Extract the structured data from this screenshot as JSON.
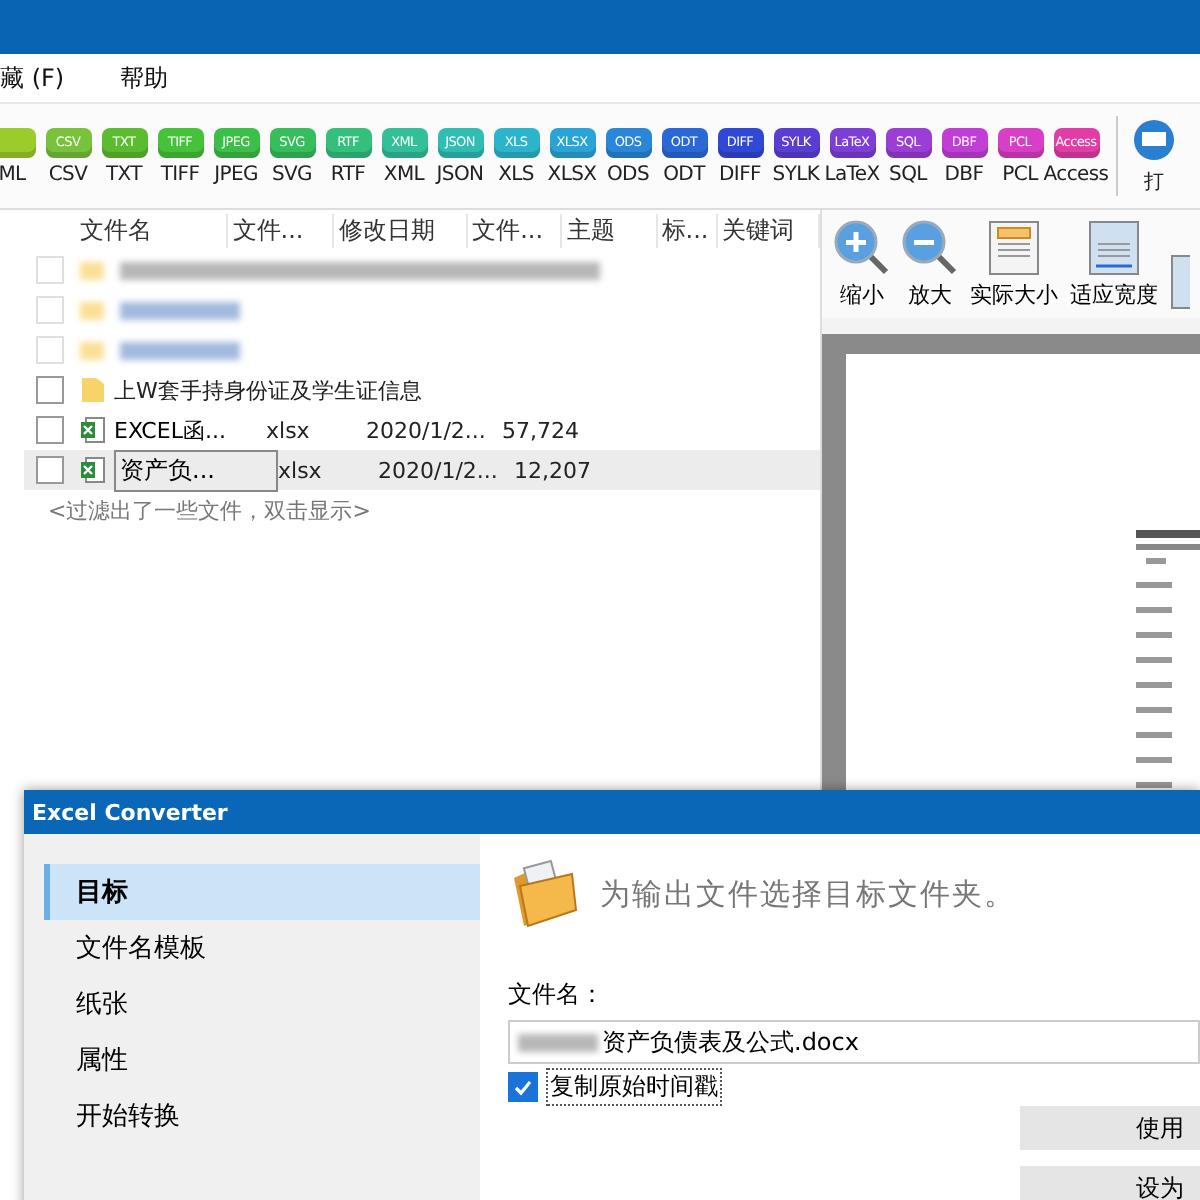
{
  "menu": [
    {
      "label": "藏 (F)"
    },
    {
      "label": "帮助"
    }
  ],
  "formats": [
    {
      "label": "ML",
      "color": "#9ccc2c"
    },
    {
      "badge": "CSV",
      "label": "CSV",
      "color": "#78c23c"
    },
    {
      "badge": "TXT",
      "label": "TXT",
      "color": "#5cbc30"
    },
    {
      "badge": "TIFF",
      "label": "TIFF",
      "color": "#46c23a"
    },
    {
      "badge": "JPEG",
      "label": "JPEG",
      "color": "#3cbf48"
    },
    {
      "badge": "SVG",
      "label": "SVG",
      "color": "#36be5c"
    },
    {
      "badge": "RTF",
      "label": "RTF",
      "color": "#34c07c"
    },
    {
      "badge": "XML",
      "label": "XML",
      "color": "#33bf98"
    },
    {
      "badge": "JSON",
      "label": "JSON",
      "color": "#2fbdb4"
    },
    {
      "badge": "XLS",
      "label": "XLS",
      "color": "#2cb4cc"
    },
    {
      "badge": "XLSX",
      "label": "XLSX",
      "color": "#2aa4d6"
    },
    {
      "badge": "ODS",
      "label": "ODS",
      "color": "#2a86d6"
    },
    {
      "badge": "ODT",
      "label": "ODT",
      "color": "#2a68d6"
    },
    {
      "badge": "DIFF",
      "label": "DIFF",
      "color": "#3048d6"
    },
    {
      "badge": "SYLK",
      "label": "SYLK",
      "color": "#5a3ed4"
    },
    {
      "badge": "LaTeX",
      "label": "LaTeX",
      "color": "#7c3ed6"
    },
    {
      "badge": "SQL",
      "label": "SQL",
      "color": "#9a3ed6"
    },
    {
      "badge": "DBF",
      "label": "DBF",
      "color": "#c03ed6"
    },
    {
      "badge": "PCL",
      "label": "PCL",
      "color": "#d83ec6"
    },
    {
      "badge": "Access",
      "label": "Access",
      "color": "#e03ea6"
    }
  ],
  "print_label": "打",
  "file_list": {
    "columns": [
      "文件名",
      "文件...",
      "修改日期",
      "文件...",
      "主题",
      "标...",
      "关键词"
    ],
    "redacted_rows": [
      {
        "checked": false
      },
      {
        "checked": false
      },
      {
        "checked": false
      }
    ],
    "rows": [
      {
        "kind": "folder",
        "name": "上W套手持身份证及学生证信息",
        "selected": false,
        "checked": false
      },
      {
        "kind": "xlsx",
        "name": "EXCEL函...",
        "type": "xlsx",
        "date": "2020/1/2...",
        "size": "57,724",
        "selected": false,
        "checked": false
      },
      {
        "kind": "xlsx",
        "name": "资产负...",
        "type": "xlsx",
        "date": "2020/1/2...",
        "size": "12,207",
        "selected": true,
        "checked": false
      }
    ],
    "filter_note": "<过滤出了一些文件，双击显示>"
  },
  "preview_toolbar": [
    {
      "kind": "zoom-in",
      "label": "缩小"
    },
    {
      "kind": "zoom-out",
      "label": "放大"
    },
    {
      "kind": "actual",
      "label": "实际大小"
    },
    {
      "kind": "fit-width",
      "label": "适应宽度"
    },
    {
      "kind": "cut"
    }
  ],
  "dialog": {
    "title": "Excel Converter",
    "nav": [
      {
        "label": "目标",
        "selected": true
      },
      {
        "label": "文件名模板",
        "selected": false
      },
      {
        "label": "纸张",
        "selected": false
      },
      {
        "label": "属性",
        "selected": false
      },
      {
        "label": "开始转换",
        "selected": false
      }
    ],
    "heading": "为输出文件选择目标文件夹。",
    "filename_label": "文件名：",
    "filename_value": "资产负债表及公式.docx",
    "copy_timestamp": {
      "label": "复制原始时间戳",
      "checked": true
    },
    "buttons": [
      "使用",
      "设为"
    ]
  }
}
